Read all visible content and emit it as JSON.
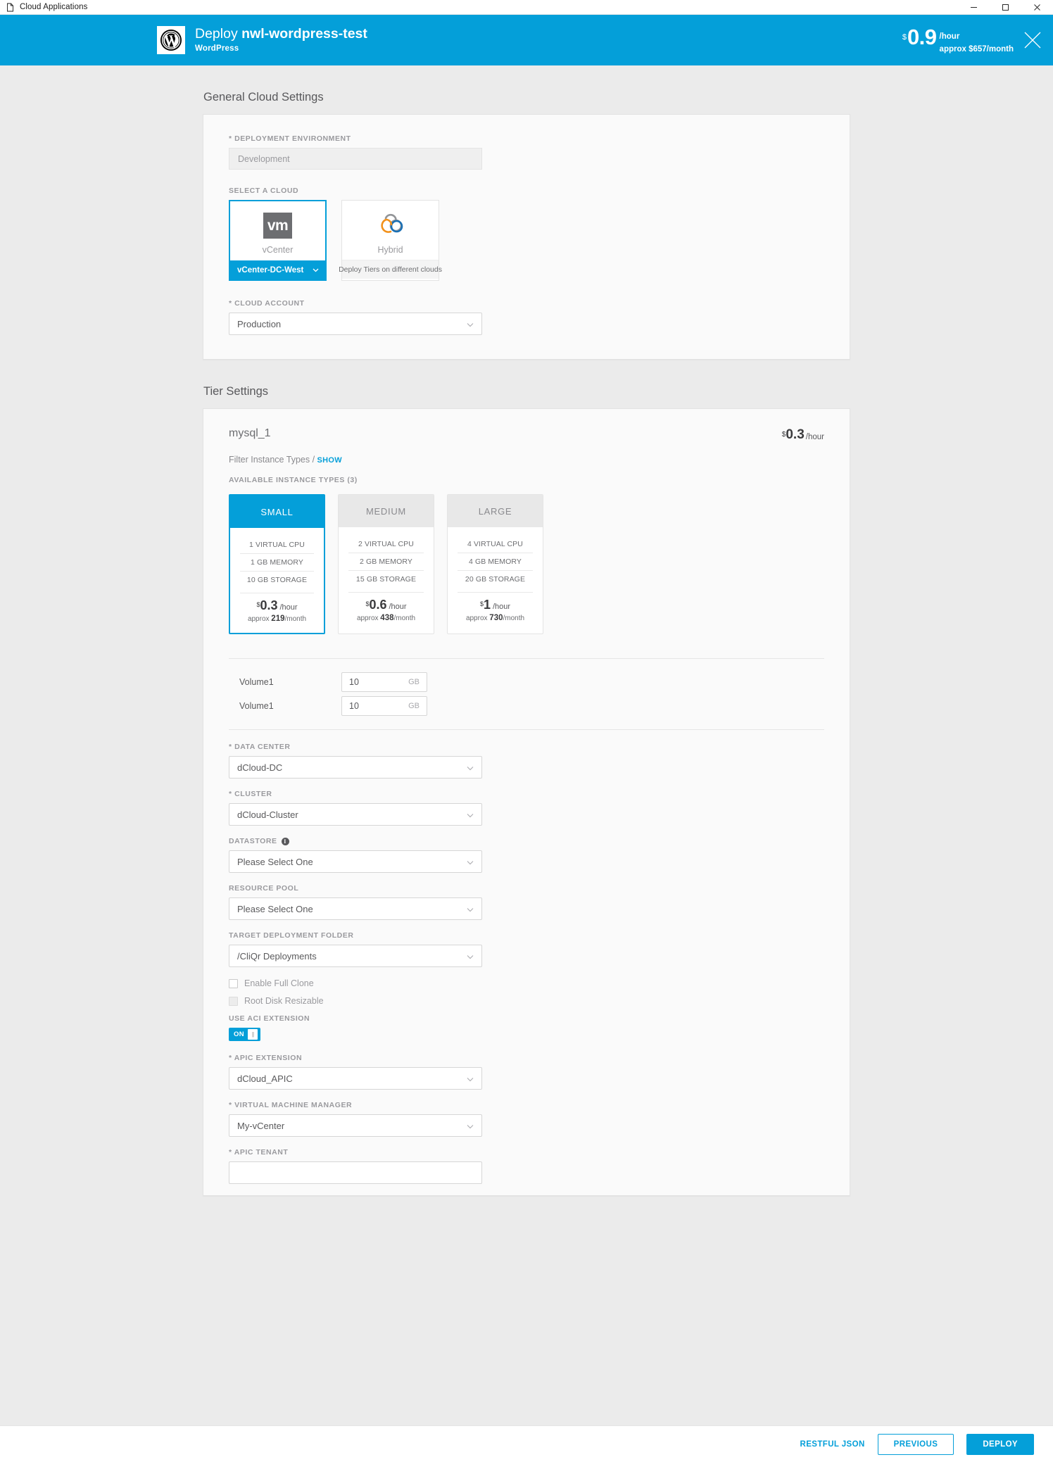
{
  "window": {
    "title": "Cloud Applications",
    "doc_icon": "document-icon",
    "minimize": "minimize-icon",
    "maximize": "maximize-icon",
    "close": "close-icon"
  },
  "header": {
    "logo_icon": "wordpress-logo-icon",
    "title_prefix": "Deploy ",
    "app_name": "nwl-wordpress-test",
    "subtitle": "WordPress",
    "price": {
      "currency": "$",
      "amount": "0.9",
      "per": "/hour",
      "approx": "approx $657/month"
    },
    "close_icon": "close-icon",
    "accent_color": "#049fd9"
  },
  "general": {
    "section_title": "General Cloud Settings",
    "deployment_environment": {
      "label": "* DEPLOYMENT ENVIRONMENT",
      "value": "Development"
    },
    "select_a_cloud": {
      "label": "SELECT A CLOUD",
      "clouds": [
        {
          "name": "vCenter",
          "icon": "vmware-vm-icon",
          "icon_text": "vm",
          "selected": true,
          "footer": "vCenter-DC-West",
          "chevron": "chevron-down-icon"
        },
        {
          "name": "Hybrid",
          "icon": "hybrid-cloud-icon",
          "selected": false,
          "footer": "Deploy Tiers on different clouds"
        }
      ]
    },
    "cloud_account": {
      "label": "* CLOUD ACCOUNT",
      "value": "Production",
      "chevron": "chevron-down-icon"
    }
  },
  "tier": {
    "section_title": "Tier Settings",
    "name": "mysql_1",
    "price": {
      "currency": "$",
      "amount": "0.3",
      "per": "/hour"
    },
    "filter": {
      "text": "Filter Instance Types /",
      "action": "SHOW"
    },
    "available_label": "AVAILABLE INSTANCE TYPES (3)",
    "instance_types": [
      {
        "name": "SMALL",
        "selected": true,
        "cpu": "1 VIRTUAL CPU",
        "memory": "1 GB MEMORY",
        "storage": "10 GB STORAGE",
        "currency": "$",
        "price": "0.3",
        "per": "/hour",
        "month_prefix": "approx ",
        "month_value": "219",
        "month_suffix": "/month"
      },
      {
        "name": "MEDIUM",
        "selected": false,
        "cpu": "2 VIRTUAL CPU",
        "memory": "2 GB MEMORY",
        "storage": "15 GB STORAGE",
        "currency": "$",
        "price": "0.6",
        "per": "/hour",
        "month_prefix": "approx ",
        "month_value": "438",
        "month_suffix": "/month"
      },
      {
        "name": "LARGE",
        "selected": false,
        "cpu": "4 VIRTUAL CPU",
        "memory": "4 GB MEMORY",
        "storage": "20 GB STORAGE",
        "currency": "$",
        "price": "1",
        "per": "/hour",
        "month_prefix": "approx ",
        "month_value": "730",
        "month_suffix": "/month"
      }
    ],
    "volumes": [
      {
        "label": "Volume1",
        "value": "10",
        "unit": "GB"
      },
      {
        "label": "Volume1",
        "value": "10",
        "unit": "GB"
      }
    ],
    "fields": [
      {
        "label": "* DATA CENTER",
        "value": "dCloud-DC",
        "info": false
      },
      {
        "label": "* CLUSTER",
        "value": "dCloud-Cluster",
        "info": false
      },
      {
        "label": "DATASTORE",
        "value": "Please Select One",
        "info": true
      },
      {
        "label": "RESOURCE POOL",
        "value": "Please Select One",
        "info": false
      },
      {
        "label": "TARGET DEPLOYMENT FOLDER",
        "value": "/CliQr Deployments",
        "info": false
      }
    ],
    "checkboxes": [
      {
        "label": "Enable Full Clone",
        "checked": false,
        "dim": false
      },
      {
        "label": "Root Disk Resizable",
        "checked": false,
        "dim": true
      }
    ],
    "aci": {
      "label": "USE ACI EXTENSION",
      "toggle_state": "ON"
    },
    "aci_fields": [
      {
        "label": "* APIC EXTENSION",
        "value": "dCloud_APIC"
      },
      {
        "label": "* VIRTUAL MACHINE MANAGER",
        "value": "My-vCenter"
      }
    ],
    "apic_tenant_label": "* APIC TENANT"
  },
  "footer": {
    "restful_json": "RESTFUL JSON",
    "previous": "PREVIOUS",
    "deploy": "DEPLOY"
  }
}
